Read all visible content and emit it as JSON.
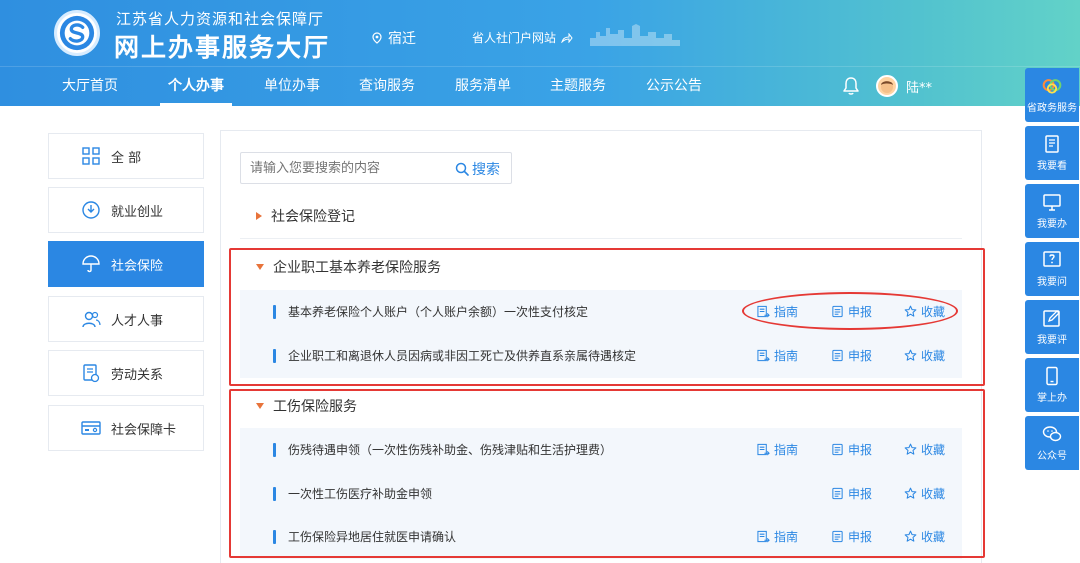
{
  "header": {
    "subtitle": "江苏省人力资源和社会保障厅",
    "title": "网上办事服务大厅",
    "location": "宿迁",
    "portal_link": "省人社门户网站"
  },
  "nav": {
    "items": [
      "大厅首页",
      "个人办事",
      "单位办事",
      "查询服务",
      "服务清单",
      "主题服务",
      "公示公告"
    ],
    "active": "个人办事",
    "username": "陆**"
  },
  "sidebar": {
    "items": [
      {
        "label": "全 部",
        "icon": "grid-icon"
      },
      {
        "label": "就业创业",
        "icon": "employment-icon"
      },
      {
        "label": "社会保险",
        "icon": "umbrella-icon",
        "active": true
      },
      {
        "label": "人才人事",
        "icon": "people-icon"
      },
      {
        "label": "劳动关系",
        "icon": "document-icon"
      },
      {
        "label": "社会保障卡",
        "icon": "card-icon"
      }
    ]
  },
  "search": {
    "placeholder": "请输入您要搜索的内容",
    "button": "搜索"
  },
  "categories": [
    {
      "label": "社会保险登记",
      "expanded": false
    },
    {
      "label": "企业职工基本养老保险服务",
      "expanded": true
    },
    {
      "label": "工伤保险服务",
      "expanded": true
    }
  ],
  "actions": {
    "guide": "指南",
    "apply": "申报",
    "favorite": "收藏"
  },
  "items": [
    {
      "title": "基本养老保险个人账户（个人账户余额）一次性支付核定",
      "has_guide": true
    },
    {
      "title": "企业职工和离退休人员因病或非因工死亡及供养直系亲属待遇核定",
      "has_guide": true
    },
    {
      "title": "伤残待遇申领（一次性伤残补助金、伤残津贴和生活护理费）",
      "has_guide": true
    },
    {
      "title": "一次性工伤医疗补助金申领",
      "has_guide": false
    },
    {
      "title": "工伤保险异地居住就医申请确认",
      "has_guide": true
    }
  ],
  "float_toolbar": [
    {
      "label": "省政务服务",
      "icon": "gov-logo-icon"
    },
    {
      "label": "我要看",
      "icon": "book-icon"
    },
    {
      "label": "我要办",
      "icon": "monitor-icon"
    },
    {
      "label": "我要问",
      "icon": "question-icon"
    },
    {
      "label": "我要评",
      "icon": "edit-icon"
    },
    {
      "label": "掌上办",
      "icon": "phone-icon"
    },
    {
      "label": "公众号",
      "icon": "wechat-icon"
    }
  ],
  "colors": {
    "primary": "#2b87e3",
    "accent_orange": "#e8733b",
    "highlight_red": "#e53935"
  }
}
